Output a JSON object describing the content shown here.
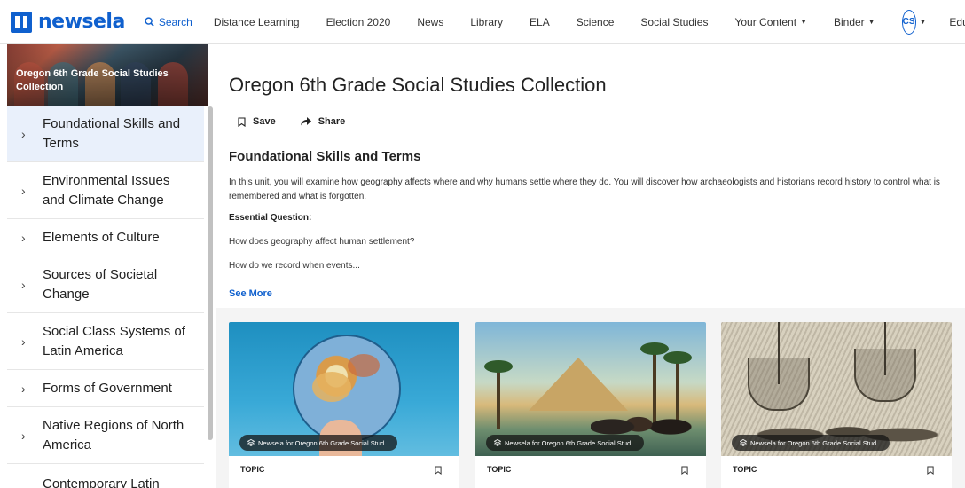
{
  "app": {
    "logo_text": "newsela"
  },
  "nav": {
    "search_label": "Search",
    "items": [
      {
        "label": "Distance Learning"
      },
      {
        "label": "Election 2020"
      },
      {
        "label": "News"
      },
      {
        "label": "Library"
      },
      {
        "label": "ELA"
      },
      {
        "label": "Science"
      },
      {
        "label": "Social Studies"
      },
      {
        "label": "Your Content"
      },
      {
        "label": "Binder"
      }
    ],
    "avatar_initials": "CS",
    "educator_label": "Educator Center"
  },
  "sidebar": {
    "banner_title": "Oregon 6th Grade Social Studies Collection",
    "items": [
      {
        "label": "Foundational Skills and Terms",
        "active": true
      },
      {
        "label": "Environmental Issues and Climate Change"
      },
      {
        "label": "Elements of Culture"
      },
      {
        "label": "Sources of Societal Change"
      },
      {
        "label": "Social Class Systems of Latin America"
      },
      {
        "label": "Forms of Government"
      },
      {
        "label": "Native Regions of North America"
      },
      {
        "label": "Contemporary Latin"
      }
    ]
  },
  "main": {
    "title": "Oregon 6th Grade Social Studies Collection",
    "save_label": "Save",
    "share_label": "Share",
    "section_title": "Foundational Skills and Terms",
    "description": "In this unit, you will examine how geography affects where and why humans settle where they do. You will discover how archaeologists and historians record history to control what is remembered and what is forgotten.",
    "essential_question_label": "Essential Question:",
    "question_1": "How does geography affect human settlement?",
    "question_2": "How do we record when events...",
    "see_more": "See More"
  },
  "cards": [
    {
      "tag": "Newsela for Oregon 6th Grade Social Stud...",
      "type": "TOPIC"
    },
    {
      "tag": "Newsela for Oregon 6th Grade Social Stud...",
      "type": "TOPIC"
    },
    {
      "tag": "Newsela for Oregon 6th Grade Social Stud...",
      "type": "TOPIC"
    }
  ],
  "colors": {
    "brand": "#0f60ce",
    "active_bg": "#e9f0fb"
  }
}
